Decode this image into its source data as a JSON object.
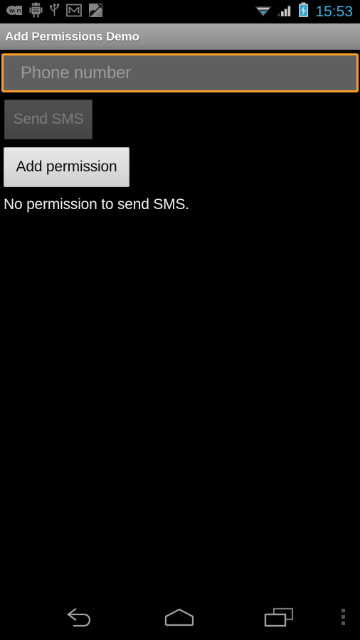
{
  "status_bar": {
    "left_icons": [
      {
        "name": "wifi-badge-icon",
        "label": "WiFi"
      },
      {
        "name": "android-debug-icon",
        "label": "Android debug"
      },
      {
        "name": "usb-icon",
        "label": "USB"
      },
      {
        "name": "gmail-icon",
        "label": "Gmail"
      },
      {
        "name": "gallery-icon",
        "label": "Gallery"
      }
    ],
    "right_icons": [
      {
        "name": "wifi-signal-icon",
        "label": "Wi-Fi signal"
      },
      {
        "name": "cellular-signal-icon",
        "label": "Cellular signal"
      },
      {
        "name": "battery-charging-icon",
        "label": "Battery charging"
      }
    ],
    "clock": "15:53",
    "clock_color": "#33b5e5"
  },
  "action_bar": {
    "title": "Add Permissions Demo"
  },
  "main": {
    "phone_input": {
      "value": "",
      "placeholder": "Phone number",
      "focused": true,
      "focus_color": "#f79a21"
    },
    "send_sms_button": {
      "label": "Send SMS",
      "enabled": false
    },
    "add_permission_button": {
      "label": "Add permission",
      "enabled": true
    },
    "permission_status": "No permission to send SMS."
  },
  "nav_bar": {
    "back_label": "Back",
    "home_label": "Home",
    "recents_label": "Recent apps",
    "menu_label": "More options"
  }
}
